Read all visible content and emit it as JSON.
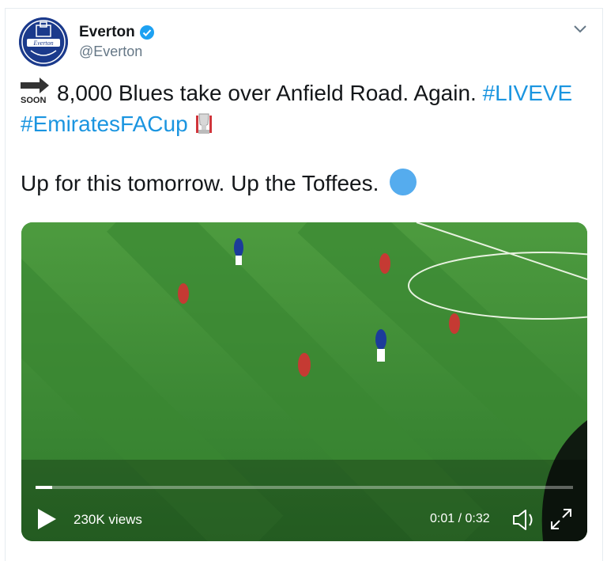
{
  "tweet": {
    "author_name": "Everton",
    "author_handle": "@Everton",
    "soon_label": "SOON",
    "line1_text": "8,000 Blues take over Anfield Road. Again. ",
    "line1_hashtag": "#LIVEVE",
    "line2_hashtag": "#EmiratesFACup",
    "line3_text": "Up for this tomorrow. Up the Toffees."
  },
  "video": {
    "views": "230K views",
    "time": "0:01 / 0:32",
    "progress": 0.031
  },
  "colors": {
    "link": "#1b95e0",
    "verified": "#1da1f2",
    "pitch": "#3f8f35"
  },
  "icons": [
    "verified-badge-icon",
    "chevron-down-icon",
    "soon-arrow-icon",
    "fa-cup-trophy-icon",
    "blue-circle-icon",
    "play-icon",
    "volume-icon",
    "fullscreen-icon"
  ]
}
